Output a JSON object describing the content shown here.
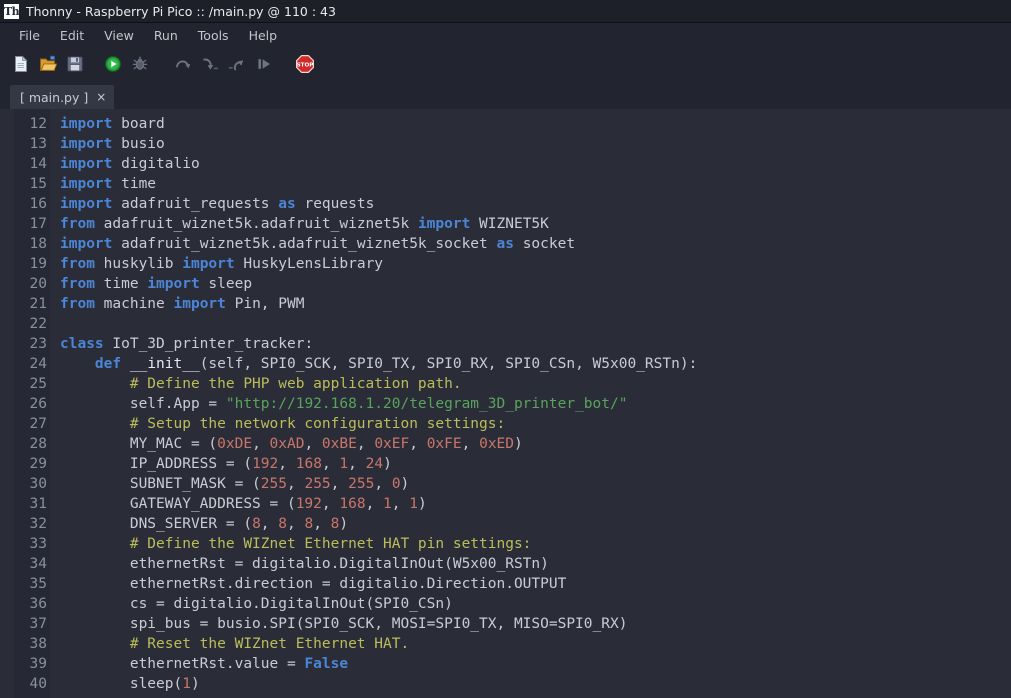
{
  "window": {
    "app_icon": "Th",
    "title": "Thonny  -  Raspberry Pi Pico :: /main.py  @  110 : 43"
  },
  "menubar": {
    "items": [
      {
        "label": "File"
      },
      {
        "label": "Edit"
      },
      {
        "label": "View"
      },
      {
        "label": "Run"
      },
      {
        "label": "Tools"
      },
      {
        "label": "Help"
      }
    ]
  },
  "toolbar": {
    "buttons": [
      {
        "name": "new-file-icon",
        "title": "New"
      },
      {
        "name": "open-file-icon",
        "title": "Load"
      },
      {
        "name": "save-file-icon",
        "title": "Save"
      },
      {
        "name": "run-icon",
        "title": "Run current script"
      },
      {
        "name": "debug-icon",
        "title": "Debug current script"
      },
      {
        "name": "step-over-icon",
        "title": "Step over"
      },
      {
        "name": "step-into-icon",
        "title": "Step into"
      },
      {
        "name": "step-out-icon",
        "title": "Step out"
      },
      {
        "name": "resume-icon",
        "title": "Resume"
      },
      {
        "name": "stop-icon",
        "title": "Stop / Restart backend"
      }
    ],
    "stop_label": "STOP"
  },
  "tabs": [
    {
      "label": "[ main.py ]",
      "close": "×",
      "active": true
    }
  ],
  "editor": {
    "first_line_number": 12,
    "colors": {
      "background": "#2a2d38",
      "gutter": "#262935",
      "keyword": "#4c85d6",
      "string": "#5aa35c",
      "comment": "#bcbd5a",
      "number": "#c9766a",
      "text": "#d4d7de",
      "line_number": "#8a8f9c"
    },
    "lines": [
      {
        "n": 12,
        "tokens": [
          {
            "t": "kw",
            "s": "import"
          },
          {
            "t": "txt",
            "s": " board"
          }
        ]
      },
      {
        "n": 13,
        "tokens": [
          {
            "t": "kw",
            "s": "import"
          },
          {
            "t": "txt",
            "s": " busio"
          }
        ]
      },
      {
        "n": 14,
        "tokens": [
          {
            "t": "kw",
            "s": "import"
          },
          {
            "t": "txt",
            "s": " digitalio"
          }
        ]
      },
      {
        "n": 15,
        "tokens": [
          {
            "t": "kw",
            "s": "import"
          },
          {
            "t": "txt",
            "s": " time"
          }
        ]
      },
      {
        "n": 16,
        "tokens": [
          {
            "t": "kw",
            "s": "import"
          },
          {
            "t": "txt",
            "s": " adafruit_requests "
          },
          {
            "t": "kw",
            "s": "as"
          },
          {
            "t": "txt",
            "s": " requests"
          }
        ]
      },
      {
        "n": 17,
        "tokens": [
          {
            "t": "kw",
            "s": "from"
          },
          {
            "t": "txt",
            "s": " adafruit_wiznet5k.adafruit_wiznet5k "
          },
          {
            "t": "kw",
            "s": "import"
          },
          {
            "t": "txt",
            "s": " WIZNET5K"
          }
        ]
      },
      {
        "n": 18,
        "tokens": [
          {
            "t": "kw",
            "s": "import"
          },
          {
            "t": "txt",
            "s": " adafruit_wiznet5k.adafruit_wiznet5k_socket "
          },
          {
            "t": "kw",
            "s": "as"
          },
          {
            "t": "txt",
            "s": " socket"
          }
        ]
      },
      {
        "n": 19,
        "tokens": [
          {
            "t": "kw",
            "s": "from"
          },
          {
            "t": "txt",
            "s": " huskylib "
          },
          {
            "t": "kw",
            "s": "import"
          },
          {
            "t": "txt",
            "s": " HuskyLensLibrary"
          }
        ]
      },
      {
        "n": 20,
        "tokens": [
          {
            "t": "kw",
            "s": "from"
          },
          {
            "t": "txt",
            "s": " time "
          },
          {
            "t": "kw",
            "s": "import"
          },
          {
            "t": "txt",
            "s": " sleep"
          }
        ]
      },
      {
        "n": 21,
        "tokens": [
          {
            "t": "kw",
            "s": "from"
          },
          {
            "t": "txt",
            "s": " machine "
          },
          {
            "t": "kw",
            "s": "import"
          },
          {
            "t": "txt",
            "s": " Pin, PWM"
          }
        ]
      },
      {
        "n": 22,
        "tokens": []
      },
      {
        "n": 23,
        "tokens": [
          {
            "t": "kw",
            "s": "class"
          },
          {
            "t": "txt",
            "s": " IoT_3D_printer_tracker:"
          }
        ]
      },
      {
        "n": 24,
        "tokens": [
          {
            "t": "txt",
            "s": "    "
          },
          {
            "t": "kw",
            "s": "def"
          },
          {
            "t": "def",
            "s": " __init__"
          },
          {
            "t": "txt",
            "s": "(self, SPI0_SCK, SPI0_TX, SPI0_RX, SPI0_CSn, W5x00_RSTn):"
          }
        ]
      },
      {
        "n": 25,
        "tokens": [
          {
            "t": "com",
            "s": "        # Define the PHP web application path."
          }
        ]
      },
      {
        "n": 26,
        "tokens": [
          {
            "t": "txt",
            "s": "        self.App = "
          },
          {
            "t": "str",
            "s": "\"http://192.168.1.20/telegram_3D_printer_bot/\""
          }
        ]
      },
      {
        "n": 27,
        "tokens": [
          {
            "t": "com",
            "s": "        # Setup the network configuration settings:"
          }
        ]
      },
      {
        "n": 28,
        "tokens": [
          {
            "t": "txt",
            "s": "        MY_MAC = ("
          },
          {
            "t": "num",
            "s": "0xDE"
          },
          {
            "t": "txt",
            "s": ", "
          },
          {
            "t": "num",
            "s": "0xAD"
          },
          {
            "t": "txt",
            "s": ", "
          },
          {
            "t": "num",
            "s": "0xBE"
          },
          {
            "t": "txt",
            "s": ", "
          },
          {
            "t": "num",
            "s": "0xEF"
          },
          {
            "t": "txt",
            "s": ", "
          },
          {
            "t": "num",
            "s": "0xFE"
          },
          {
            "t": "txt",
            "s": ", "
          },
          {
            "t": "num",
            "s": "0xED"
          },
          {
            "t": "txt",
            "s": ")"
          }
        ]
      },
      {
        "n": 29,
        "tokens": [
          {
            "t": "txt",
            "s": "        IP_ADDRESS = ("
          },
          {
            "t": "num",
            "s": "192"
          },
          {
            "t": "txt",
            "s": ", "
          },
          {
            "t": "num",
            "s": "168"
          },
          {
            "t": "txt",
            "s": ", "
          },
          {
            "t": "num",
            "s": "1"
          },
          {
            "t": "txt",
            "s": ", "
          },
          {
            "t": "num",
            "s": "24"
          },
          {
            "t": "txt",
            "s": ")"
          }
        ]
      },
      {
        "n": 30,
        "tokens": [
          {
            "t": "txt",
            "s": "        SUBNET_MASK = ("
          },
          {
            "t": "num",
            "s": "255"
          },
          {
            "t": "txt",
            "s": ", "
          },
          {
            "t": "num",
            "s": "255"
          },
          {
            "t": "txt",
            "s": ", "
          },
          {
            "t": "num",
            "s": "255"
          },
          {
            "t": "txt",
            "s": ", "
          },
          {
            "t": "num",
            "s": "0"
          },
          {
            "t": "txt",
            "s": ")"
          }
        ]
      },
      {
        "n": 31,
        "tokens": [
          {
            "t": "txt",
            "s": "        GATEWAY_ADDRESS = ("
          },
          {
            "t": "num",
            "s": "192"
          },
          {
            "t": "txt",
            "s": ", "
          },
          {
            "t": "num",
            "s": "168"
          },
          {
            "t": "txt",
            "s": ", "
          },
          {
            "t": "num",
            "s": "1"
          },
          {
            "t": "txt",
            "s": ", "
          },
          {
            "t": "num",
            "s": "1"
          },
          {
            "t": "txt",
            "s": ")"
          }
        ]
      },
      {
        "n": 32,
        "tokens": [
          {
            "t": "txt",
            "s": "        DNS_SERVER = ("
          },
          {
            "t": "num",
            "s": "8"
          },
          {
            "t": "txt",
            "s": ", "
          },
          {
            "t": "num",
            "s": "8"
          },
          {
            "t": "txt",
            "s": ", "
          },
          {
            "t": "num",
            "s": "8"
          },
          {
            "t": "txt",
            "s": ", "
          },
          {
            "t": "num",
            "s": "8"
          },
          {
            "t": "txt",
            "s": ")"
          }
        ]
      },
      {
        "n": 33,
        "tokens": [
          {
            "t": "com",
            "s": "        # Define the WIZnet Ethernet HAT pin settings:"
          }
        ]
      },
      {
        "n": 34,
        "tokens": [
          {
            "t": "txt",
            "s": "        ethernetRst = digitalio.DigitalInOut(W5x00_RSTn)"
          }
        ]
      },
      {
        "n": 35,
        "tokens": [
          {
            "t": "txt",
            "s": "        ethernetRst.direction = digitalio.Direction.OUTPUT"
          }
        ]
      },
      {
        "n": 36,
        "tokens": [
          {
            "t": "txt",
            "s": "        cs = digitalio.DigitalInOut(SPI0_CSn)"
          }
        ]
      },
      {
        "n": 37,
        "tokens": [
          {
            "t": "txt",
            "s": "        spi_bus = busio.SPI(SPI0_SCK, MOSI=SPI0_TX, MISO=SPI0_RX)"
          }
        ]
      },
      {
        "n": 38,
        "tokens": [
          {
            "t": "com",
            "s": "        # Reset the WIZnet Ethernet HAT."
          }
        ]
      },
      {
        "n": 39,
        "tokens": [
          {
            "t": "txt",
            "s": "        ethernetRst.value = "
          },
          {
            "t": "kw",
            "s": "False"
          }
        ]
      },
      {
        "n": 40,
        "tokens": [
          {
            "t": "txt",
            "s": "        sleep("
          },
          {
            "t": "num",
            "s": "1"
          },
          {
            "t": "txt",
            "s": ")"
          }
        ]
      }
    ]
  }
}
